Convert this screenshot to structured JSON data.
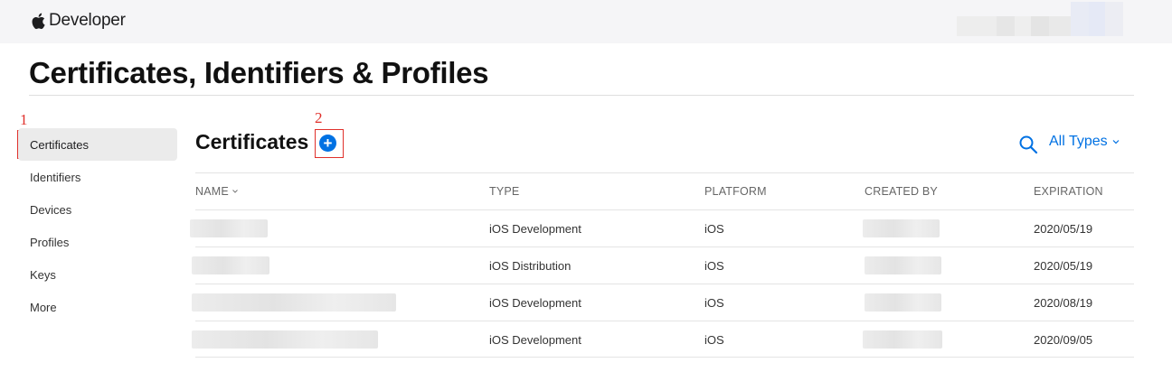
{
  "header": {
    "brand": "Developer",
    "logo_icon": "apple-logo-icon"
  },
  "page": {
    "title": "Certificates, Identifiers & Profiles"
  },
  "annotations": {
    "callout_1": "1",
    "callout_2": "2",
    "color": "#e0302b"
  },
  "sidebar": {
    "items": [
      {
        "label": "Certificates",
        "active": true
      },
      {
        "label": "Identifiers"
      },
      {
        "label": "Devices"
      },
      {
        "label": "Profiles"
      },
      {
        "label": "Keys"
      },
      {
        "label": "More"
      }
    ]
  },
  "section": {
    "title": "Certificates",
    "add_symbol": "+",
    "add_icon": "plus-circle-icon",
    "search_icon": "search-icon",
    "filter_label": "All Types",
    "filter_icon": "chevron-down-icon"
  },
  "table": {
    "columns": [
      "NAME",
      "TYPE",
      "PLATFORM",
      "CREATED BY",
      "EXPIRATION"
    ],
    "rows": [
      {
        "name": "",
        "type": "iOS Development",
        "platform": "iOS",
        "created_by": "",
        "expiration": "2020/05/19"
      },
      {
        "name": "",
        "type": "iOS Distribution",
        "platform": "iOS",
        "created_by": "",
        "expiration": "2020/05/19"
      },
      {
        "name": "",
        "type": "iOS Development",
        "platform": "iOS",
        "created_by": "",
        "expiration": "2020/08/19"
      },
      {
        "name": "",
        "type": "iOS Development",
        "platform": "iOS",
        "created_by": "",
        "expiration": "2020/09/05"
      }
    ]
  },
  "colors": {
    "accent": "#0071e3",
    "topbar_bg": "#f5f5f7",
    "active_item_bg": "#ebebeb"
  }
}
